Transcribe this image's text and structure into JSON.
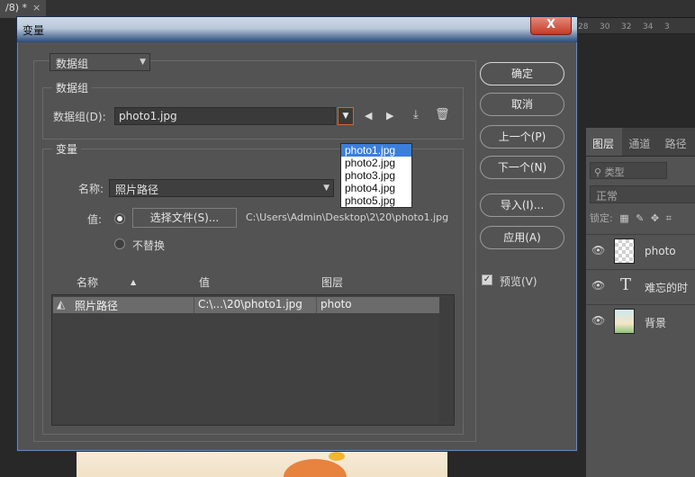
{
  "document_tab": {
    "label": "/8) *",
    "close": "×"
  },
  "ruler": {
    "ticks": [
      "28",
      "30",
      "32",
      "34",
      "3"
    ]
  },
  "layers_panel": {
    "tabs": [
      "图层",
      "通道",
      "路径"
    ],
    "search_placeholder": "类型",
    "blend_mode": "正常",
    "lock_label": "锁定:",
    "layers": [
      {
        "name": "photo",
        "kind": "smart"
      },
      {
        "name": "难忘的时",
        "kind": "text"
      },
      {
        "name": "背景",
        "kind": "image"
      }
    ]
  },
  "dialog": {
    "title": "变量",
    "close_label": "X",
    "top_select": "数据组",
    "dataset_group": {
      "legend": "数据组",
      "label": "数据组(D):",
      "value": "photo1.jpg",
      "options": [
        "photo1.jpg",
        "photo2.jpg",
        "photo3.jpg",
        "photo4.jpg",
        "photo5.jpg"
      ],
      "selected_index": 0
    },
    "variable_group": {
      "legend": "变量",
      "name_label": "名称:",
      "name_value": "照片路径",
      "value_label": "值:",
      "choose_file_button": "选择文件(S)...",
      "file_path": "C:\\Users\\Admin\\Desktop\\2\\20\\photo1.jpg",
      "no_replace_label": "不替换",
      "table": {
        "headers": [
          "名称",
          "值",
          "图层"
        ],
        "rows": [
          {
            "name": "照片路径",
            "value": "C:\\...\\20\\photo1.jpg",
            "layer": "photo"
          }
        ]
      }
    },
    "buttons": {
      "ok": "确定",
      "cancel": "取消",
      "prev": "上一个(P)",
      "next": "下一个(N)",
      "import": "导入(I)...",
      "apply": "应用(A)"
    },
    "preview": {
      "label": "预览(V)",
      "checked": true
    }
  }
}
